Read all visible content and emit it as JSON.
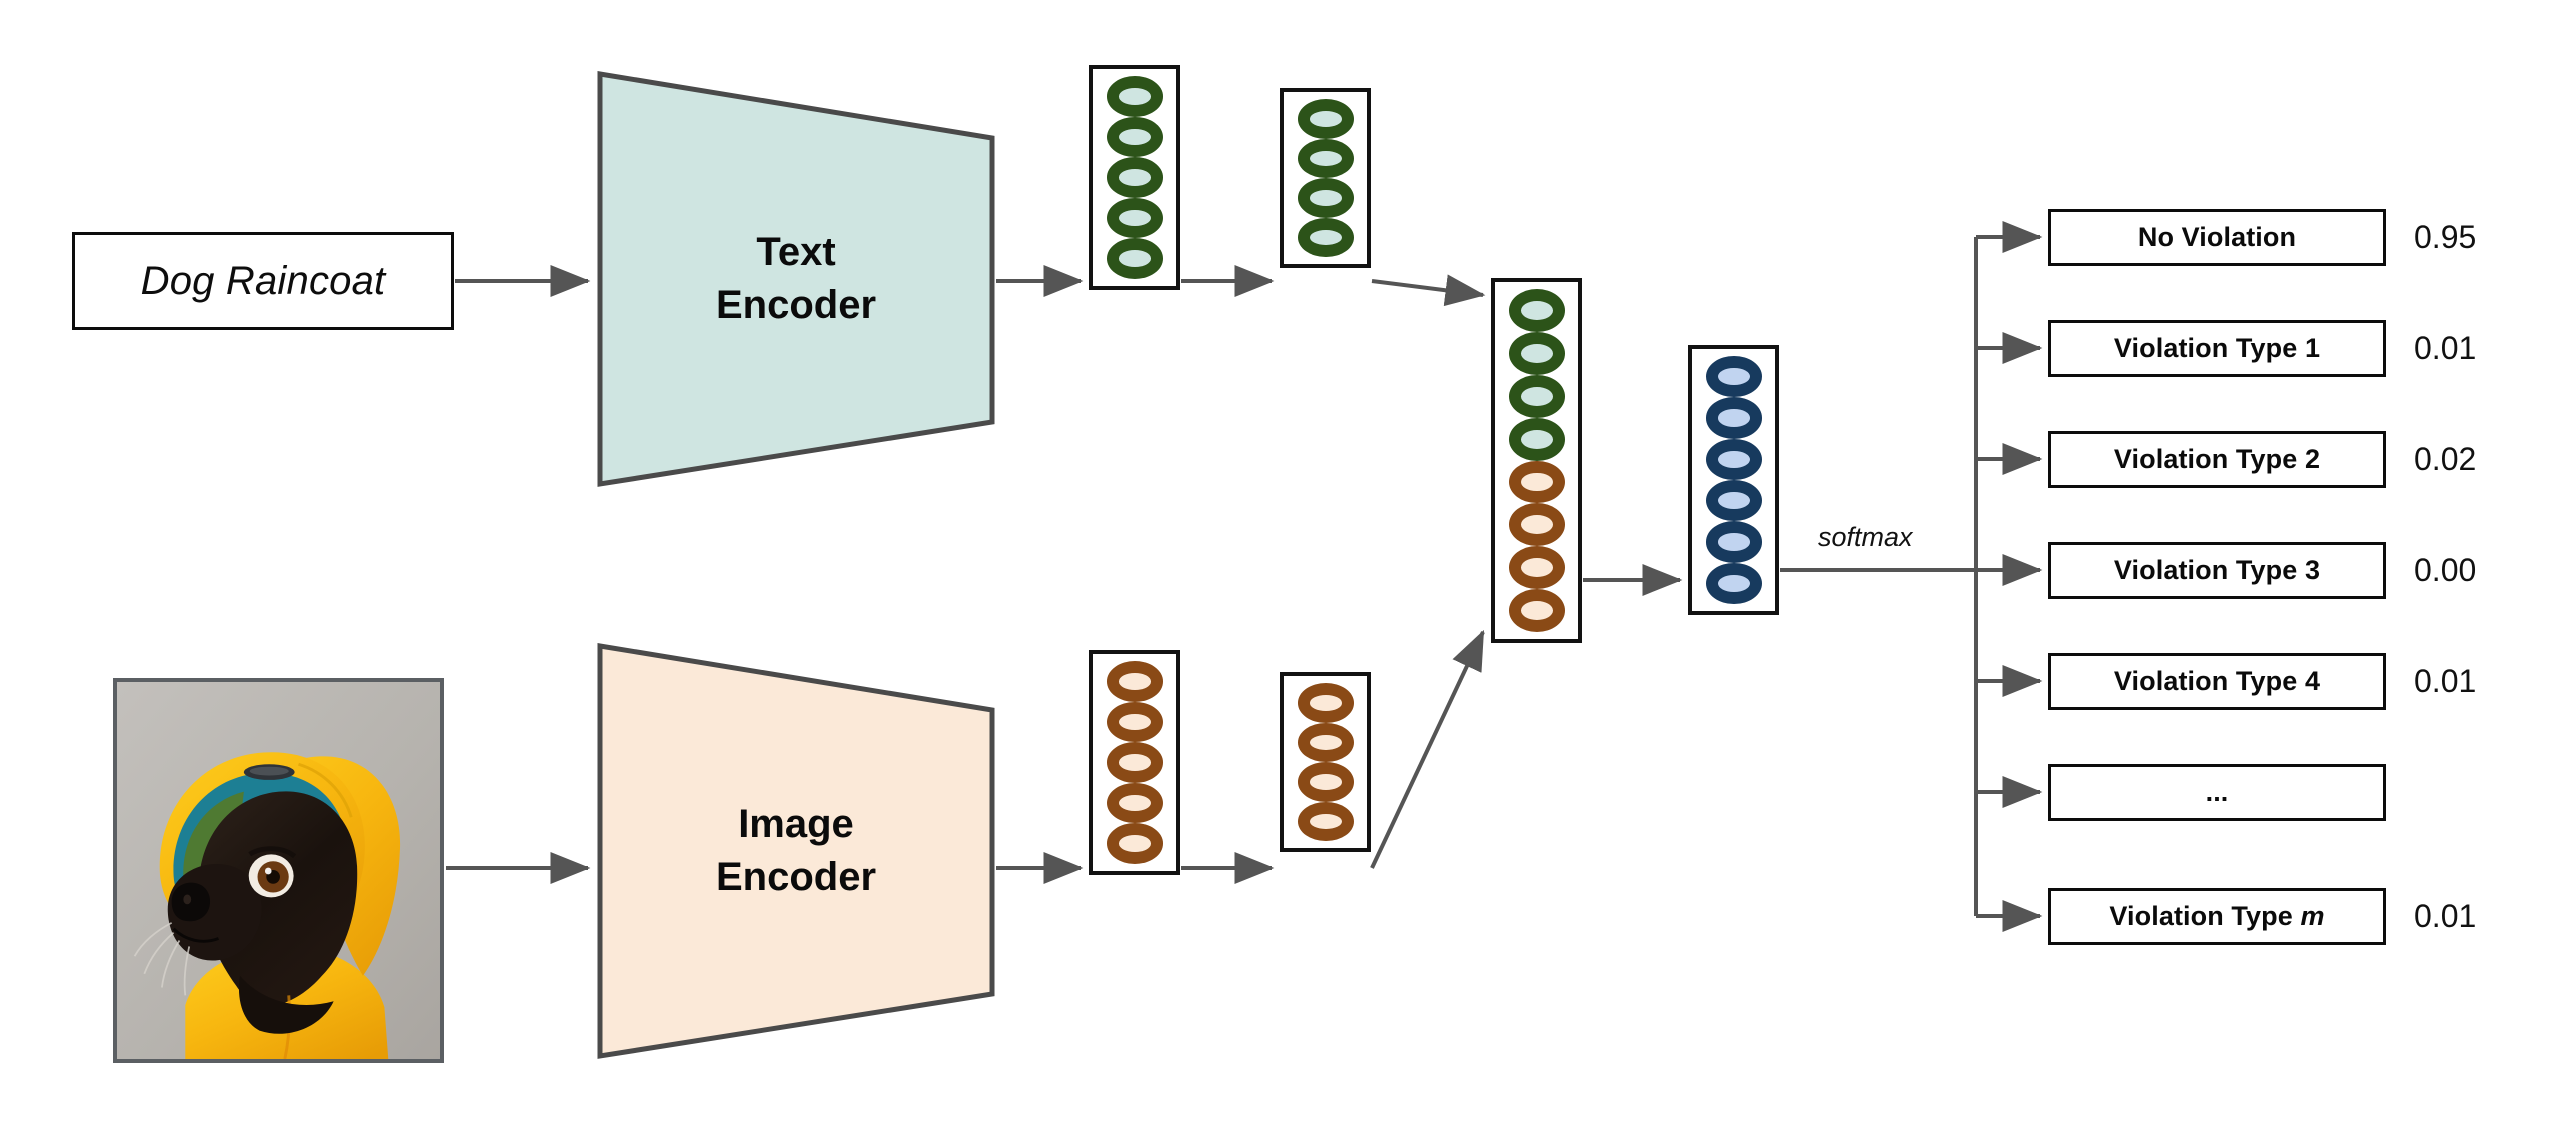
{
  "diagram": {
    "title": "Multimodal violation classification pipeline",
    "prompt": {
      "text": "Dog Raincoat"
    },
    "photo": {
      "alt": "black pug wearing a yellow raincoat hood",
      "coat_color": "#f7b814",
      "lining_color": "#1d7f94",
      "background_color": "#b9b6b2",
      "dog_color": "#1c1411"
    },
    "encoders": [
      {
        "id": "text-encoder",
        "label_line1": "Text",
        "label_line2": "Encoder",
        "fill": "#cfe5e1",
        "stroke": "#4a4a4a"
      },
      {
        "id": "image-encoder",
        "label_line1": "Image",
        "label_line2": "Encoder",
        "fill": "#fbe9d8",
        "stroke": "#4a4a4a"
      }
    ],
    "columns": [
      {
        "id": "col-text-1",
        "modality": "text",
        "node_color": "green",
        "count": 5
      },
      {
        "id": "col-text-2",
        "modality": "text",
        "node_color": "green",
        "count": 4
      },
      {
        "id": "col-img-1",
        "modality": "image",
        "node_color": "brown",
        "count": 5
      },
      {
        "id": "col-img-2",
        "modality": "image",
        "node_color": "brown",
        "count": 4
      },
      {
        "id": "col-fusion",
        "modality": "fused",
        "node_colors": [
          "green",
          "green",
          "green",
          "green",
          "brown",
          "brown",
          "brown",
          "brown"
        ],
        "count": 8
      },
      {
        "id": "col-logits",
        "modality": "logits",
        "node_color": "blue",
        "count": 6
      }
    ],
    "softmax_label": "softmax",
    "outputs": [
      {
        "label": "No Violation",
        "prob": "0.95"
      },
      {
        "label": "Violation Type 1",
        "prob": "0.01"
      },
      {
        "label": "Violation Type 2",
        "prob": "0.02"
      },
      {
        "label": "Violation Type 3",
        "prob": "0.00"
      },
      {
        "label": "Violation Type 4",
        "prob": "0.01"
      },
      {
        "label": "...",
        "prob": ""
      },
      {
        "label": "Violation Type m",
        "label_prefix": "Violation Type ",
        "label_italic": "m",
        "prob": "0.01"
      }
    ],
    "colors": {
      "green_ring": "#2c5319",
      "green_fill": "#cfe5e1",
      "brown_ring": "#8a4a16",
      "brown_fill": "#fbe9d8",
      "blue_ring": "#173a5e",
      "blue_fill": "#c1d4f0",
      "text_encoder_fill": "#cfe5e1",
      "image_encoder_fill": "#fbe9d8",
      "arrow": "#555555",
      "box_border": "#0c0c0c",
      "background": "#ffffff"
    }
  }
}
